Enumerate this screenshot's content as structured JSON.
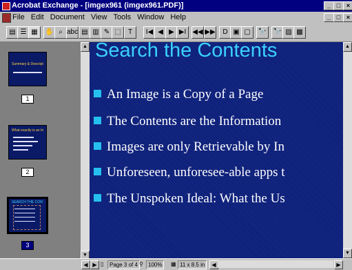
{
  "window": {
    "title": "Acrobat Exchange - [imgex961 (imgex961.PDF)]",
    "controls": [
      "_",
      "□",
      "×"
    ]
  },
  "menu": [
    "File",
    "Edit",
    "Document",
    "View",
    "Tools",
    "Window",
    "Help"
  ],
  "toolbar": {
    "buttons": [
      {
        "name": "page-only-view-icon",
        "glyph": "▤"
      },
      {
        "name": "bookmarks-view-icon",
        "glyph": "☰"
      },
      {
        "name": "thumbnails-view-icon",
        "glyph": "▦",
        "pressed": true
      },
      {
        "name": "hand-tool-icon",
        "glyph": "✋"
      },
      {
        "name": "zoom-tool-icon",
        "glyph": "⌕"
      },
      {
        "name": "text-select-tool-icon",
        "glyph": "abc"
      },
      {
        "name": "graphics-select-tool-icon",
        "glyph": "▤"
      },
      {
        "name": "article-tool-icon",
        "glyph": "▥"
      },
      {
        "name": "link-tool-icon",
        "glyph": "✎"
      },
      {
        "name": "crop-tool-icon",
        "glyph": "⬚"
      },
      {
        "name": "touchup-text-icon",
        "glyph": "T"
      },
      {
        "name": "first-page-icon",
        "glyph": "I◀"
      },
      {
        "name": "previous-page-icon",
        "glyph": "◀"
      },
      {
        "name": "next-page-icon",
        "glyph": "▶"
      },
      {
        "name": "last-page-icon",
        "glyph": "▶I"
      },
      {
        "name": "go-back-icon",
        "glyph": "◀◀"
      },
      {
        "name": "go-forward-icon",
        "glyph": "▶▶"
      },
      {
        "name": "actual-size-icon",
        "glyph": "D"
      },
      {
        "name": "fit-page-icon",
        "glyph": "▣"
      },
      {
        "name": "fit-width-icon",
        "glyph": "▢"
      },
      {
        "name": "find-icon",
        "glyph": "🔭"
      },
      {
        "name": "search-icon",
        "glyph": "🔭"
      },
      {
        "name": "search-results-icon",
        "glyph": "▨"
      },
      {
        "name": "next-hit-icon",
        "glyph": "▩"
      }
    ]
  },
  "thumbnails": [
    {
      "page": "1",
      "title": "Summary & Description",
      "selected": false
    },
    {
      "page": "2",
      "title": "What exactly is an Image in a file?",
      "selected": false
    },
    {
      "page": "3",
      "title": "SEARCH THE CONTENTS",
      "selected": true
    }
  ],
  "slide": {
    "title": "Search the Contents",
    "bullets": [
      "An Image is a Copy of a Page",
      "The Contents are the Information",
      "Images are only Retrievable by In",
      "Unforeseen, unforesee-able apps t",
      "The Unspoken Ideal:  What the Us"
    ]
  },
  "status": {
    "page": "Page 3 of 4",
    "zoom": "100%",
    "size": "11 x 8.5 in"
  },
  "colors": {
    "titlebar": "#000080",
    "slide_bg": "#0c1f7a",
    "slide_title": "#3ad0ff",
    "bullet_square": "#25c0ef"
  }
}
